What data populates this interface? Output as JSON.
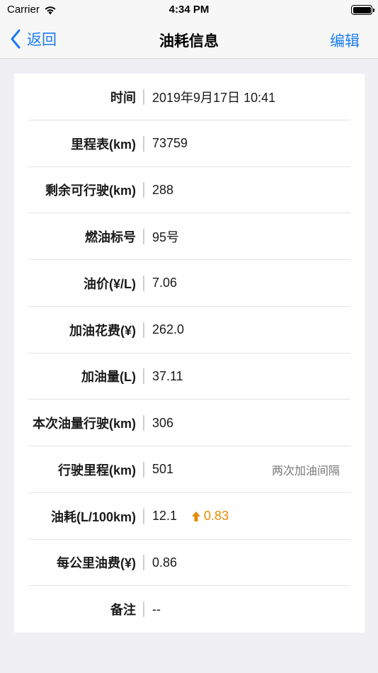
{
  "status": {
    "carrier": "Carrier",
    "time": "4:34 PM"
  },
  "nav": {
    "back_label": "返回",
    "title": "油耗信息",
    "edit_label": "编辑"
  },
  "rows": [
    {
      "label": "时间",
      "value": "2019年9月17日 10:41"
    },
    {
      "label": "里程表(km)",
      "value": "73759"
    },
    {
      "label": "剩余可行驶(km)",
      "value": "288"
    },
    {
      "label": "燃油标号",
      "value": "95号"
    },
    {
      "label": "油价(¥/L)",
      "value": "7.06"
    },
    {
      "label": "加油花费(¥)",
      "value": "262.0"
    },
    {
      "label": "加油量(L)",
      "value": "37.11"
    },
    {
      "label": "本次油量行驶(km)",
      "value": "306"
    },
    {
      "label": "行驶里程(km)",
      "value": "501",
      "note": "两次加油间隔"
    },
    {
      "label": "油耗(L/100km)",
      "value": "12.1",
      "trend": "0.83"
    },
    {
      "label": "每公里油费(¥)",
      "value": "0.86"
    },
    {
      "label": "备注",
      "value": "--"
    }
  ],
  "colors": {
    "accent": "#1a7cf4",
    "trend_up": "#e78b00"
  }
}
